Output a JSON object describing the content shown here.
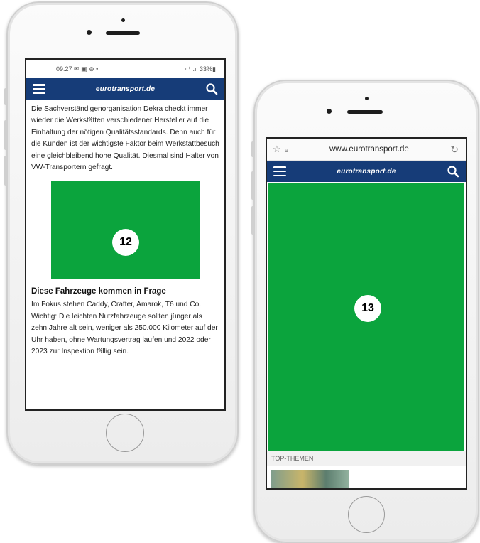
{
  "left_phone": {
    "status": {
      "time": "09:27",
      "indicators": "✉ ▣ ⊖ •",
      "right_icons": "ⁿ⁺ .ıl 33%▮"
    },
    "header": {
      "brand": "eurotransport.de"
    },
    "article": {
      "intro": "Die Sachverständigenorganisation Dekra checkt immer wieder die Werkstätten verschiedener Hersteller auf die Einhaltung der nötigen Qualitätsstandards. Denn auch für die Kunden ist der wichtigste Faktor beim Werkstattbesuch eine gleichbleibend hohe Qualität. Diesmal sind Halter von VW-Transportern gefragt.",
      "badge": "12",
      "heading": "Diese Fahrzeuge kommen in Frage",
      "body": "Im Fokus stehen Caddy, Crafter, Amarok, T6 und Co. Wichtig: Die leichten Nutzfahrzeuge sollten jünger als zehn Jahre alt sein, weniger als 250.000 Kilometer auf der Uhr haben, ohne Wartungsvertrag laufen und 2022 oder 2023 zur Inspektion fällig sein."
    }
  },
  "right_phone": {
    "browser": {
      "url": "www.eurotransport.de"
    },
    "header": {
      "brand": "eurotransport.de"
    },
    "badge": "13",
    "section_label": "TOP-THEMEN"
  },
  "colors": {
    "header_blue": "#163c78",
    "placeholder_green": "#0ba43d"
  },
  "icons": [
    "hamburger-menu-icon",
    "search-icon",
    "star-icon",
    "lock-icon",
    "reload-icon"
  ]
}
